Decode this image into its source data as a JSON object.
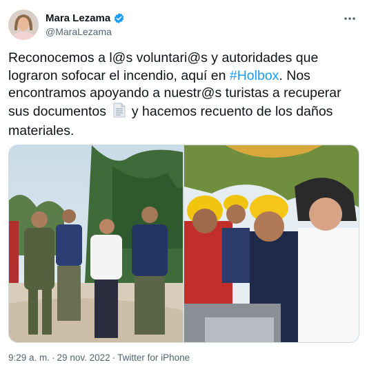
{
  "author": {
    "display_name": "Mara Lezama",
    "handle": "@MaraLezama",
    "verified": true
  },
  "tweet": {
    "text_part1": "Reconocemos a l@s voluntari@s y autoridades que lograron sofocar el incendio, aquí en ",
    "hashtag": "#Holbox",
    "text_part2": ". Nos encontramos apoyando a nuestr@s turistas a recuperar sus documentos ",
    "emoji": "page-facing-up-icon",
    "text_part3": " y hacemos recuento de los daños materiales."
  },
  "media": {
    "photos": [
      {
        "description_icon": "photo-1"
      },
      {
        "description_icon": "photo-2"
      }
    ]
  },
  "meta": {
    "time": "9:29 a. m.",
    "separator": "·",
    "date": "29 nov. 2022",
    "separator2": "·",
    "source": "Twitter for iPhone"
  },
  "colors": {
    "link": "#1d9bf0",
    "verified": "#1d9bf0",
    "secondary_text": "#536471"
  }
}
